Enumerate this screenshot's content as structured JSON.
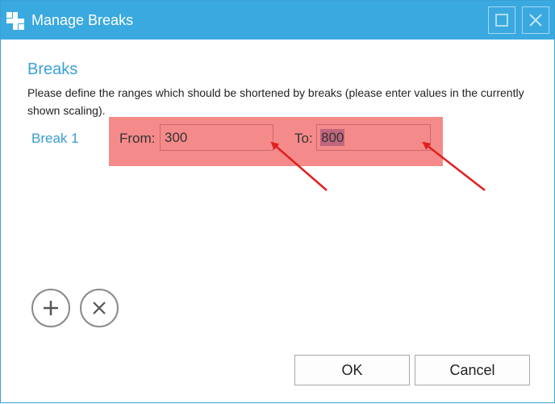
{
  "window": {
    "title": "Manage Breaks",
    "icons": {
      "app": "app-logo-icon",
      "maximize": "maximize-icon",
      "close": "close-icon"
    }
  },
  "content": {
    "section_title": "Breaks",
    "description": "Please define the ranges which should be shortened by breaks (please enter values in the currently shown scaling)."
  },
  "breaks": [
    {
      "label": "Break 1",
      "from_label": "From:",
      "from_value": "300",
      "to_label": "To:",
      "to_value": "800"
    }
  ],
  "actions": {
    "add_icon": "plus-icon",
    "remove_icon": "x-icon",
    "ok": "OK",
    "cancel": "Cancel"
  },
  "colors": {
    "titlebar": "#3aa9e0",
    "accent": "#3aa1d8",
    "highlight": "#f58a8a",
    "annotation_arrow": "#e02020"
  }
}
